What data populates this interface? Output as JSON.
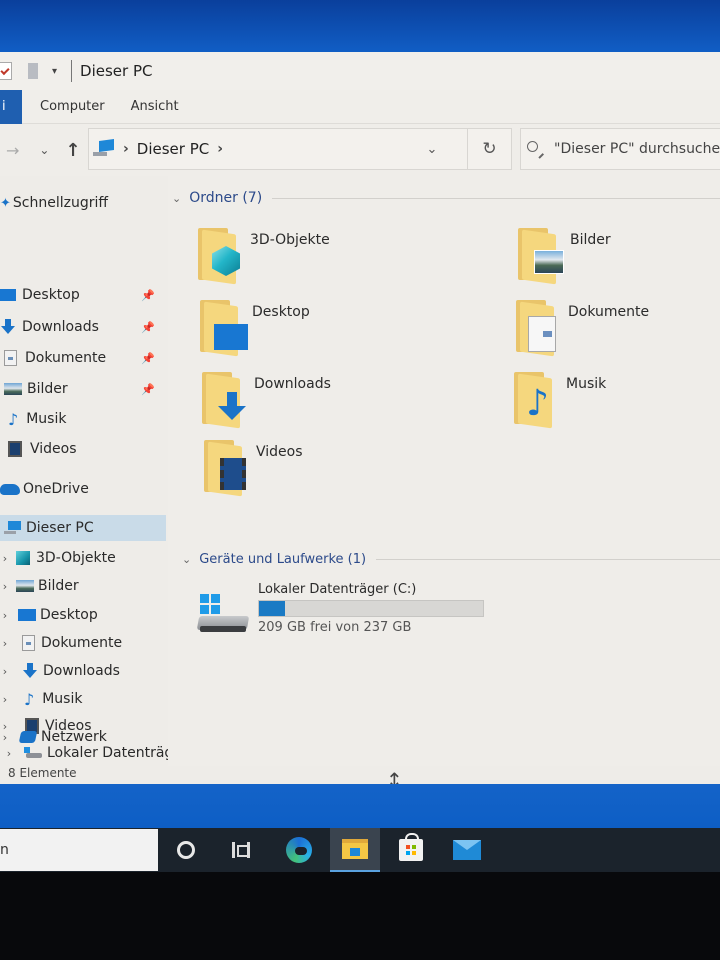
{
  "window": {
    "title": "Dieser PC",
    "ribbon_tabs": [
      {
        "label": "i",
        "active": true
      },
      {
        "label": "Computer"
      },
      {
        "label": "Ansicht"
      }
    ]
  },
  "navigation": {
    "back_icon": "arrow-right-icon",
    "recent_icon": "chevron-down-icon",
    "up_icon": "arrow-up-icon",
    "breadcrumb": [
      {
        "label": "Dieser PC",
        "icon": "this-pc-icon"
      }
    ],
    "search_placeholder": "\"Dieser PC\" durchsuchen"
  },
  "sidebar": {
    "quick_access": {
      "label": "Schnellzugriff",
      "items": [
        {
          "label": "Desktop",
          "icon": "desktop-icon",
          "pinned": true
        },
        {
          "label": "Downloads",
          "icon": "download-icon",
          "pinned": true
        },
        {
          "label": "Dokumente",
          "icon": "document-icon",
          "pinned": true
        },
        {
          "label": "Bilder",
          "icon": "pictures-icon",
          "pinned": true
        },
        {
          "label": "Musik",
          "icon": "music-icon",
          "pinned": false
        },
        {
          "label": "Videos",
          "icon": "video-icon",
          "pinned": false
        }
      ]
    },
    "onedrive": {
      "label": "OneDrive"
    },
    "this_pc": {
      "label": "Dieser PC",
      "selected": true,
      "children": [
        {
          "label": "3D-Objekte",
          "icon": "3d-objects-icon"
        },
        {
          "label": "Bilder",
          "icon": "pictures-icon"
        },
        {
          "label": "Desktop",
          "icon": "desktop-icon"
        },
        {
          "label": "Dokumente",
          "icon": "document-icon"
        },
        {
          "label": "Downloads",
          "icon": "download-icon"
        },
        {
          "label": "Musik",
          "icon": "music-icon"
        },
        {
          "label": "Videos",
          "icon": "video-icon"
        },
        {
          "label": "Lokaler Datenträger",
          "icon": "drive-icon"
        }
      ]
    },
    "network": {
      "label": "Netzwerk"
    }
  },
  "content": {
    "folders_group": {
      "label": "Ordner (7)",
      "items": [
        {
          "label": "3D-Objekte",
          "icon": "3d-objects-folder-icon"
        },
        {
          "label": "Bilder",
          "icon": "pictures-folder-icon"
        },
        {
          "label": "Desktop",
          "icon": "desktop-folder-icon"
        },
        {
          "label": "Dokumente",
          "icon": "documents-folder-icon"
        },
        {
          "label": "Downloads",
          "icon": "downloads-folder-icon"
        },
        {
          "label": "Musik",
          "icon": "music-folder-icon"
        },
        {
          "label": "Videos",
          "icon": "videos-folder-icon"
        }
      ]
    },
    "devices_group": {
      "label": "Geräte und Laufwerke (1)",
      "drives": [
        {
          "label": "Lokaler Datenträger (C:)",
          "free_text": "209 GB frei von 237 GB",
          "free_gb": 209,
          "total_gb": 237,
          "used_fraction": 0.118
        }
      ]
    }
  },
  "status_bar": {
    "item_count": "8 Elemente"
  },
  "taskbar": {
    "search_text": "n",
    "apps": [
      {
        "name": "cortana",
        "icon": "cortana-icon"
      },
      {
        "name": "task-view",
        "icon": "task-view-icon"
      },
      {
        "name": "edge",
        "icon": "edge-icon"
      },
      {
        "name": "file-explorer",
        "icon": "file-explorer-icon",
        "active": true
      },
      {
        "name": "microsoft-store",
        "icon": "store-icon"
      },
      {
        "name": "mail",
        "icon": "mail-icon"
      }
    ]
  },
  "colors": {
    "accent": "#1a7ac4",
    "selection": "#c9dbe8",
    "group_header": "#2c4a8a"
  }
}
